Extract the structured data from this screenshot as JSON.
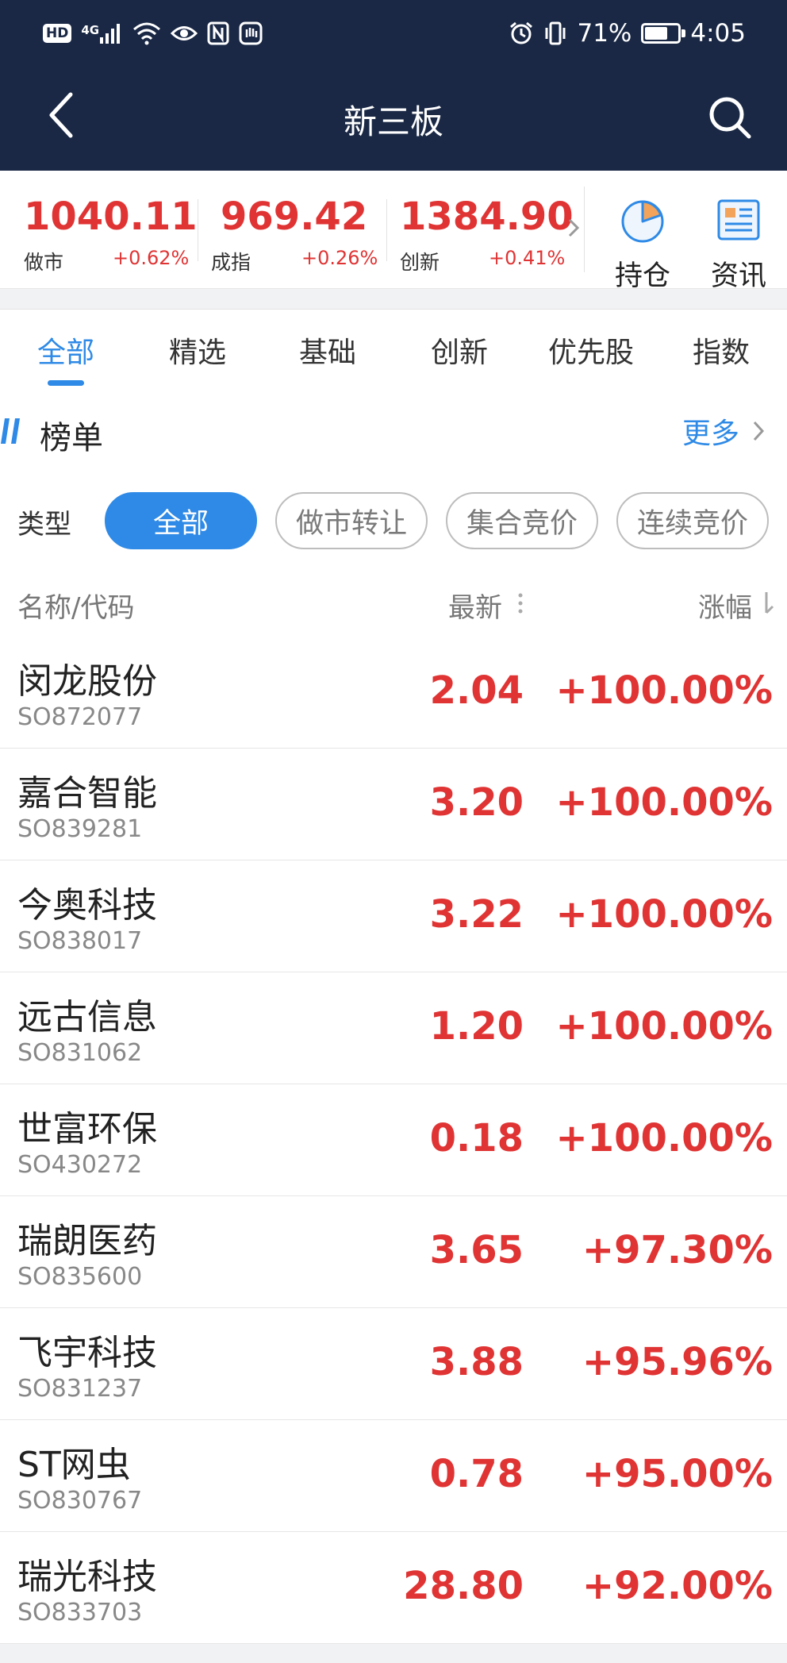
{
  "status_bar": {
    "hd": "HD",
    "network": "4G",
    "battery_text": "71%",
    "battery_level": 0.71,
    "time": "4:05",
    "icons": [
      "signal-icon",
      "wifi-icon",
      "eye-icon",
      "nfc-icon",
      "hand-icon",
      "alarm-icon",
      "vibrate-icon",
      "battery-icon"
    ]
  },
  "header": {
    "title": "新三板",
    "back_icon": "chevron-left-icon",
    "search_icon": "search-icon"
  },
  "colors": {
    "header_bg": "#1a2845",
    "accent": "#2e8ae6",
    "up": "#e03434"
  },
  "indices": [
    {
      "value": "1040.11",
      "name": "做市",
      "change": "+0.62%"
    },
    {
      "value": "969.42",
      "name": "成指",
      "change": "+0.26%"
    },
    {
      "value": "1384.90",
      "name": "创新",
      "change": "+0.41%"
    }
  ],
  "quick_links": [
    {
      "label": "持仓",
      "icon": "pie-chart-icon"
    },
    {
      "label": "资讯",
      "icon": "news-icon"
    }
  ],
  "tabs": [
    {
      "label": "全部",
      "active": true
    },
    {
      "label": "精选",
      "active": false
    },
    {
      "label": "基础",
      "active": false
    },
    {
      "label": "创新",
      "active": false
    },
    {
      "label": "优先股",
      "active": false
    },
    {
      "label": "指数",
      "active": false
    }
  ],
  "ranking": {
    "title": "榜单",
    "more": "更多"
  },
  "filter": {
    "label": "类型",
    "options": [
      {
        "label": "全部",
        "active": true
      },
      {
        "label": "做市转让",
        "active": false
      },
      {
        "label": "集合竞价",
        "active": false
      },
      {
        "label": "连续竞价",
        "active": false
      }
    ]
  },
  "columns": {
    "name": "名称/代码",
    "latest": "最新",
    "change": "涨幅"
  },
  "rows": [
    {
      "name": "闵龙股份",
      "code": "SO872077",
      "latest": "2.04",
      "change": "+100.00%"
    },
    {
      "name": "嘉合智能",
      "code": "SO839281",
      "latest": "3.20",
      "change": "+100.00%"
    },
    {
      "name": "今奥科技",
      "code": "SO838017",
      "latest": "3.22",
      "change": "+100.00%"
    },
    {
      "name": "远古信息",
      "code": "SO831062",
      "latest": "1.20",
      "change": "+100.00%"
    },
    {
      "name": "世富环保",
      "code": "SO430272",
      "latest": "0.18",
      "change": "+100.00%"
    },
    {
      "name": "瑞朗医药",
      "code": "SO835600",
      "latest": "3.65",
      "change": "+97.30%"
    },
    {
      "name": "飞宇科技",
      "code": "SO831237",
      "latest": "3.88",
      "change": "+95.96%"
    },
    {
      "name": "ST网虫",
      "code": "SO830767",
      "latest": "0.78",
      "change": "+95.00%"
    },
    {
      "name": "瑞光科技",
      "code": "SO833703",
      "latest": "28.80",
      "change": "+92.00%"
    }
  ]
}
